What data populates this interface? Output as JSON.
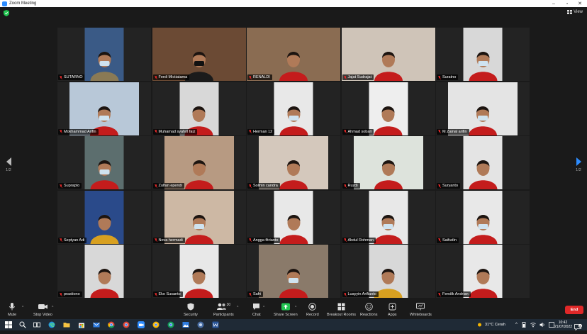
{
  "window": {
    "title": "Zoom Meeting"
  },
  "topbar": {
    "view_label": "View"
  },
  "participants": [
    {
      "name": "SUTARNO",
      "bg": "#3a5a86",
      "shirt": "#8a7a55",
      "mask": true,
      "w": 55
    },
    {
      "name": "Ferdi Mictiatama",
      "bg": "#6b4a34",
      "shirt": "#1b1b1b",
      "mask": true,
      "w": 132,
      "active": true
    },
    {
      "name": "RENALDI",
      "bg": "#8a6c52",
      "shirt": "#c41c1c",
      "mask": false,
      "w": 132
    },
    {
      "name": "Jajat Sudrajat",
      "bg": "#cfc4b8",
      "shirt": "#c41c1c",
      "mask": false,
      "w": 132
    },
    {
      "name": "Suratno",
      "bg": "#d8d8d8",
      "shirt": "#c41c1c",
      "mask": true,
      "w": 55
    },
    {
      "name": "Mokhammad Arifin",
      "bg": "#b8c8d8",
      "shirt": "#c41c1c",
      "mask": true,
      "w": 98
    },
    {
      "name": "Muhamad syahril faiz",
      "bg": "#d8d8d8",
      "shirt": "#c41c1c",
      "mask": false,
      "w": 55
    },
    {
      "name": "Herman 12",
      "bg": "#e8e8e8",
      "shirt": "#c41c1c",
      "mask": true,
      "w": 55
    },
    {
      "name": "Ahmad sobari",
      "bg": "#eeeeee",
      "shirt": "#c41c1c",
      "mask": false,
      "w": 55
    },
    {
      "name": "M Zainal arifin",
      "bg": "#e4e4e4",
      "shirt": "#c41c1c",
      "mask": true,
      "w": 98
    },
    {
      "name": "Suprapto",
      "bg": "#5c6e6e",
      "shirt": "#c41c1c",
      "mask": true,
      "w": 55
    },
    {
      "name": "Zulfan ependi",
      "bg": "#b79a82",
      "shirt": "#c41c1c",
      "mask": false,
      "w": 98
    },
    {
      "name": "Solihin candra",
      "bg": "#d4c8bc",
      "shirt": "#c41c1c",
      "mask": false,
      "w": 98
    },
    {
      "name": "Ruzdi",
      "bg": "#dde3dc",
      "shirt": "#c41c1c",
      "mask": false,
      "w": 98
    },
    {
      "name": "Suryanto",
      "bg": "#e4e4e4",
      "shirt": "#c41c1c",
      "mask": false,
      "w": 55
    },
    {
      "name": "Septyan Adi",
      "bg": "#2a4a8a",
      "shirt": "#d8a020",
      "mask": false,
      "w": 55
    },
    {
      "name": "Nova hermadi",
      "bg": "#cdb8a4",
      "shirt": "#c41c1c",
      "mask": true,
      "w": 98
    },
    {
      "name": "Angga fitrianto",
      "bg": "#e8e8e8",
      "shirt": "#c41c1c",
      "mask": false,
      "w": 55
    },
    {
      "name": "Abdul Rohman",
      "bg": "#e8e8e8",
      "shirt": "#c41c1c",
      "mask": true,
      "w": 55
    },
    {
      "name": "Saifudin",
      "bg": "#e8e8e8",
      "shirt": "#c41c1c",
      "mask": true,
      "w": 55
    },
    {
      "name": "prastiono",
      "bg": "#d8d8d8",
      "shirt": "#c41c1c",
      "mask": false,
      "w": 55
    },
    {
      "name": "Eko Susanto",
      "bg": "#e8e8e8",
      "shirt": "#c41c1c",
      "mask": false,
      "w": 55
    },
    {
      "name": "Safri",
      "bg": "#8a7a6a",
      "shirt": "#c41c1c",
      "mask": true,
      "w": 98
    },
    {
      "name": "Luayyin Arifianto",
      "bg": "#d8d8d8",
      "shirt": "#d8a020",
      "mask": false,
      "w": 55
    },
    {
      "name": "Fendik Andrian",
      "bg": "#e8e8e8",
      "shirt": "#c41c1c",
      "mask": false,
      "w": 55
    }
  ],
  "pagination": {
    "left_label": "1/2",
    "right_label": "1/2"
  },
  "toolbar": {
    "mute": "Mute",
    "stop_video": "Stop Video",
    "security": "Security",
    "participants": "Participants",
    "participants_count": "30",
    "chat": "Chat",
    "share_screen": "Share Screen",
    "record": "Record",
    "breakout_rooms": "Breakout Rooms",
    "reactions": "Reactions",
    "apps": "Apps",
    "whiteboards": "Whiteboards",
    "end": "End"
  },
  "taskbar": {
    "weather": "31°C  Cerah",
    "time": "10:42",
    "date": "21/07/2022",
    "notification_count": "8"
  },
  "colors": {
    "accent": "#2d8cff",
    "active_speaker": "#d6e23a",
    "end": "#e02828",
    "share": "#23c552"
  }
}
